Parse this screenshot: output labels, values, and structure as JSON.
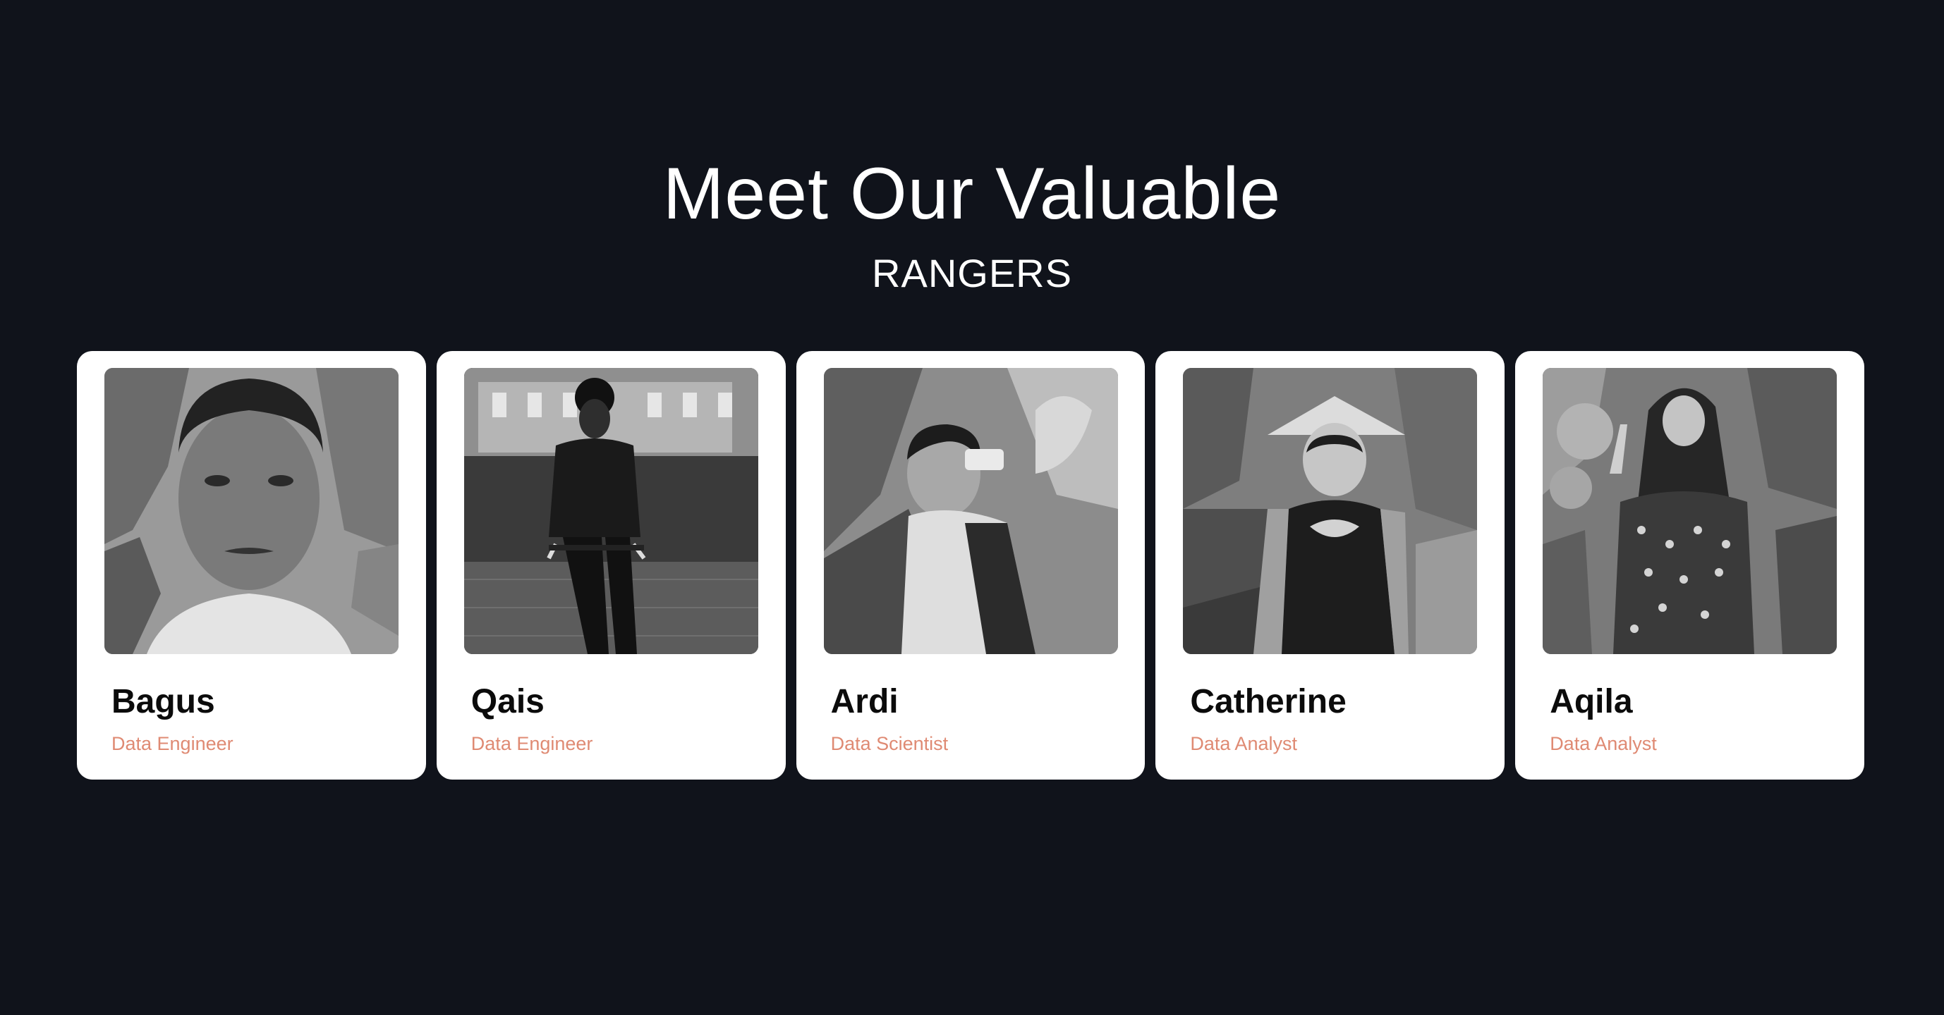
{
  "heading": {
    "title": "Meet Our Valuable",
    "subtitle": "RANGERS"
  },
  "team": [
    {
      "name": "Bagus",
      "role": "Data Engineer",
      "photo_icon": "person-portrait-photo"
    },
    {
      "name": "Qais",
      "role": "Data Engineer",
      "photo_icon": "person-on-bicycle-photo"
    },
    {
      "name": "Ardi",
      "role": "Data Scientist",
      "photo_icon": "person-with-camera-photo"
    },
    {
      "name": "Catherine",
      "role": "Data Analyst",
      "photo_icon": "person-with-hat-photo"
    },
    {
      "name": "Aqila",
      "role": "Data Analyst",
      "photo_icon": "person-in-hijab-photo"
    }
  ],
  "colors": {
    "background": "#10131b",
    "card": "#ffffff",
    "role_text": "#df8a73",
    "name_text": "#0b0b0b"
  }
}
